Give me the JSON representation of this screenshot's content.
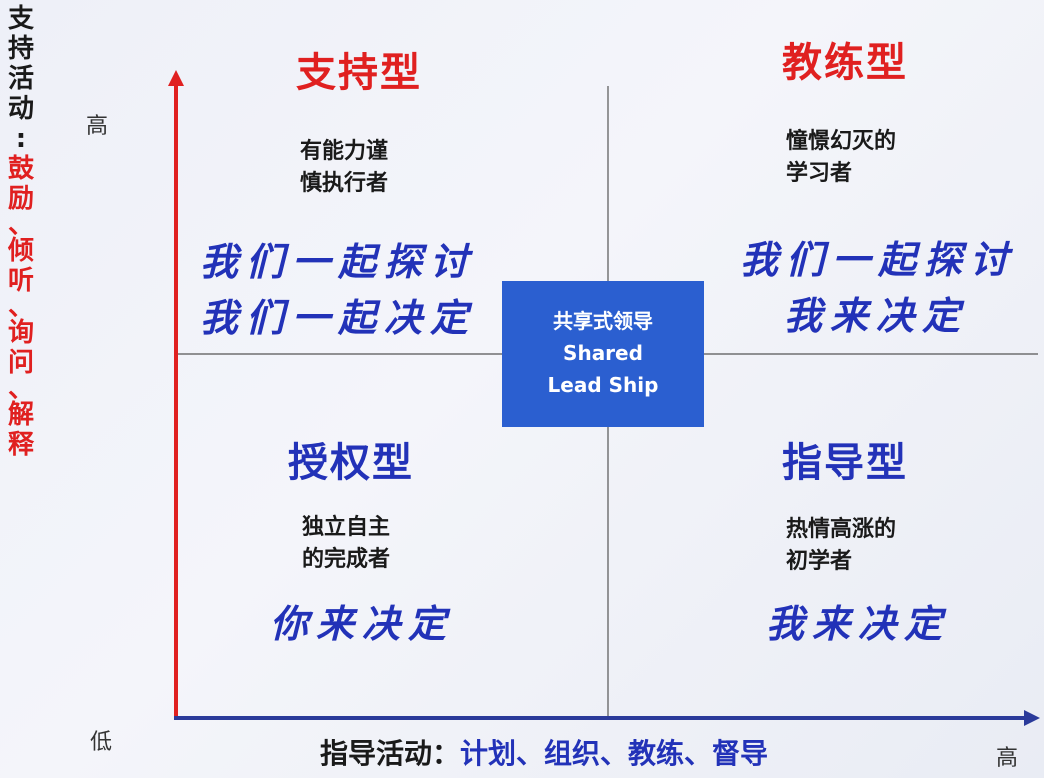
{
  "y_axis": {
    "title": "支持活动",
    "colon": ":",
    "activities": [
      "鼓励",
      "、",
      "倾听",
      "、",
      "询问",
      "、",
      "解释"
    ],
    "tick_high": "高",
    "tick_low": "低"
  },
  "x_axis": {
    "title": "指导活动：",
    "activities": "计划、组织、教练、督导",
    "tick_high": "高"
  },
  "center": {
    "line1": "共享式领导",
    "line2": "Shared",
    "line3": "Lead Ship"
  },
  "quadrants": {
    "top_left": {
      "title": "支持型",
      "desc_line1": "有能力谨",
      "desc_line2": "慎执行者",
      "phrase_line1": "我们一起探讨",
      "phrase_line2": "我们一起决定"
    },
    "top_right": {
      "title": "教练型",
      "desc_line1": "憧憬幻灭的",
      "desc_line2": "学习者",
      "phrase_line1": "我们一起探讨",
      "phrase_line2": "我来决定"
    },
    "bottom_left": {
      "title": "授权型",
      "desc_line1": "独立自主",
      "desc_line2": "的完成者",
      "phrase_line1": "你来决定"
    },
    "bottom_right": {
      "title": "指导型",
      "desc_line1": "热情高涨的",
      "desc_line2": "初学者",
      "phrase_line1": "我来决定"
    }
  },
  "colors": {
    "red_accent": "#e02020",
    "blue_text": "#2232b8",
    "center_box": "#2b5fd0",
    "axis_x": "#2a3a9a"
  }
}
